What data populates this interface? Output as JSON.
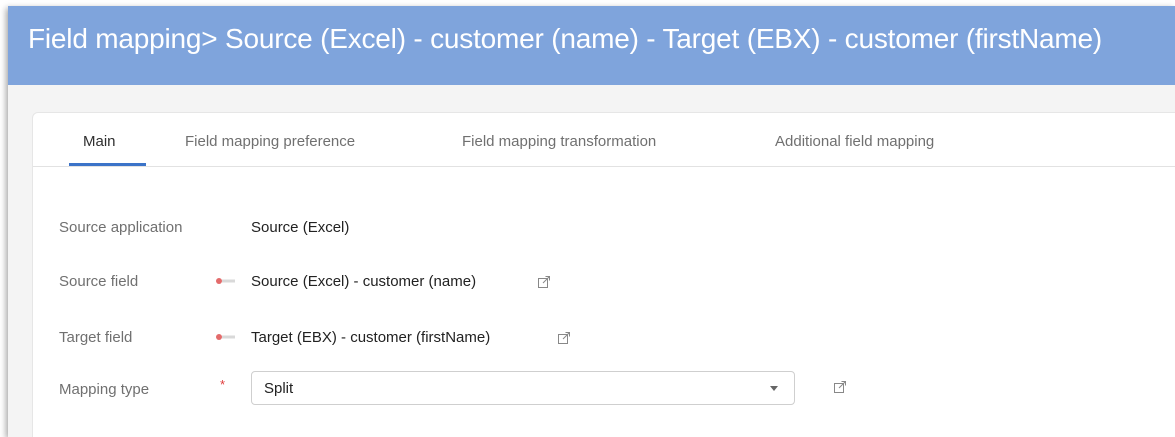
{
  "header": {
    "title": "Field mapping> Source (Excel) - customer (name) - Target (EBX) - customer (firstName)"
  },
  "tabs": [
    {
      "label": "Main",
      "active": true
    },
    {
      "label": "Field mapping preference",
      "active": false
    },
    {
      "label": "Field mapping transformation",
      "active": false
    },
    {
      "label": "Additional field mapping",
      "active": false
    }
  ],
  "form": {
    "source_application": {
      "label": "Source application",
      "value": "Source (Excel)"
    },
    "source_field": {
      "label": "Source field",
      "value": "Source (Excel) - customer (name)",
      "icon": "link-icon"
    },
    "target_field": {
      "label": "Target field",
      "value": "Target (EBX) - customer (firstName)",
      "icon": "link-icon"
    },
    "mapping_type": {
      "label": "Mapping type",
      "required_marker": "*",
      "value": "Split"
    }
  },
  "colors": {
    "header_bg": "#7fa4dc",
    "tab_accent": "#3b73c8",
    "required": "#e03a3a"
  }
}
